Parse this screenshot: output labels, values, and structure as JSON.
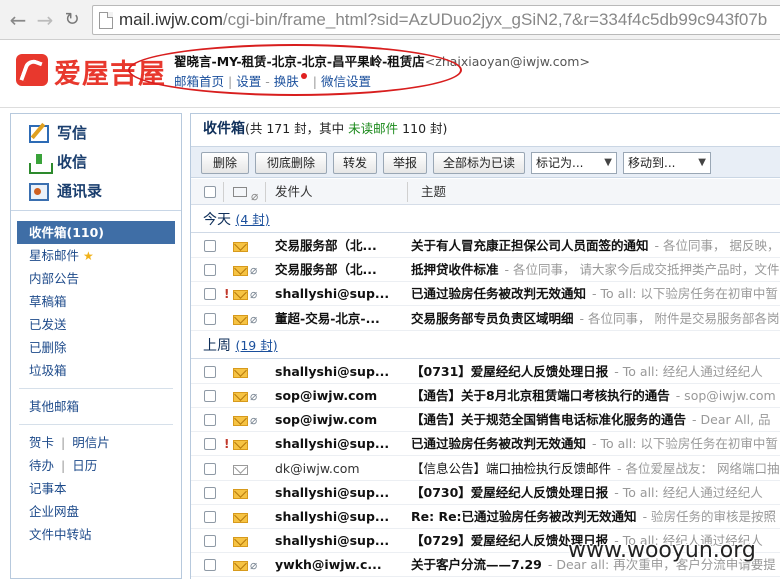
{
  "browser": {
    "url_host": "mail.iwjw.com",
    "url_path": "/cgi-bin/frame_html?sid=AzUDuo2jyx_gSiN2,7&r=334f4c5db99c943f07b"
  },
  "header": {
    "logo_text": "爱屋吉屋",
    "account_name": "翟晓言-MY-租赁-北京-北京-昌平果岭-租赁店",
    "account_email": "<zhaixiaoyan@iwjw.com>",
    "links": [
      "邮箱首页",
      "设置",
      "换肤",
      "微信设置"
    ]
  },
  "sidebar": {
    "quick": [
      {
        "label": "写信",
        "icon": "compose-icon"
      },
      {
        "label": "收信",
        "icon": "receive-icon"
      },
      {
        "label": "通讯录",
        "icon": "address-book-icon"
      }
    ],
    "folders": [
      {
        "label": "收件箱(110)",
        "active": true
      },
      {
        "label": "星标邮件",
        "star": true
      },
      {
        "label": "内部公告"
      },
      {
        "label": "草稿箱"
      },
      {
        "label": "已发送"
      },
      {
        "label": "已删除"
      },
      {
        "label": "垃圾箱"
      }
    ],
    "other": "其他邮箱",
    "tools": [
      [
        "贺卡",
        "明信片"
      ],
      [
        "待办",
        "日历"
      ]
    ],
    "extras": [
      "记事本",
      "企业网盘",
      "文件中转站"
    ]
  },
  "inbox": {
    "title": "收件箱",
    "summary_pre": "(共 171 封，其中",
    "unread_label": "未读邮件",
    "summary_post": "110 封)",
    "toolbar": {
      "delete": "删除",
      "perm_delete": "彻底删除",
      "forward": "转发",
      "report": "举报",
      "mark_all_read": "全部标为已读",
      "mark_as": "标记为...",
      "move_to": "移动到..."
    },
    "columns": {
      "sender": "发件人",
      "subject": "主题"
    },
    "groups": [
      {
        "label": "今天",
        "count": "(4 封)",
        "rows": [
          {
            "sender": "交易服务部（北...",
            "subject": "关于有人冒充康正担保公司人员面签的通知",
            "preview": "- 各位同事， 据反映，",
            "read": false,
            "attach": false,
            "flag": false
          },
          {
            "sender": "交易服务部（北...",
            "subject": "抵押贷收件标准",
            "preview": "- 各位同事， 请大家今后成交抵押类产品时，文件",
            "read": false,
            "attach": true,
            "flag": false
          },
          {
            "sender": "shallyshi@sup...",
            "subject": "已通过验房任务被改判无效通知",
            "preview": "- To all: 以下验房任务在初审中暂",
            "read": false,
            "attach": true,
            "flag": true
          },
          {
            "sender": "董超-交易-北京-...",
            "subject": "交易服务部专员负责区域明细",
            "preview": "- 各位同事， 附件是交易服务部各岗",
            "read": false,
            "attach": true,
            "flag": false
          }
        ]
      },
      {
        "label": "上周",
        "count": "(19 封)",
        "rows": [
          {
            "sender": "shallyshi@sup...",
            "subject": "【0731】爱屋经纪人反馈处理日报",
            "preview": "- To all: 经纪人通过经纪人",
            "read": false,
            "attach": false,
            "flag": false
          },
          {
            "sender": "sop@iwjw.com",
            "subject": "【通告】关于8月北京租赁端口考核执行的通告",
            "preview": "- sop@iwjw.com",
            "read": false,
            "attach": true,
            "flag": false
          },
          {
            "sender": "sop@iwjw.com",
            "subject": "【通告】关于规范全国销售电话标准化服务的通告",
            "preview": "- Dear All, 品",
            "read": false,
            "attach": true,
            "flag": false
          },
          {
            "sender": "shallyshi@sup...",
            "subject": "已通过验房任务被改判无效通知",
            "preview": "- To all: 以下验房任务在初审中暂",
            "read": false,
            "attach": false,
            "flag": true
          },
          {
            "sender": "dk@iwjw.com",
            "subject": "【信息公告】端口抽检执行反馈邮件",
            "preview": "- 各位爱屋战友： 网络端口抽检",
            "read": true,
            "attach": false,
            "flag": false
          },
          {
            "sender": "shallyshi@sup...",
            "subject": "【0730】爱屋经纪人反馈处理日报",
            "preview": "- To all: 经纪人通过经纪人",
            "read": false,
            "attach": false,
            "flag": false
          },
          {
            "sender": "shallyshi@sup...",
            "subject": "Re: Re:已通过验房任务被改判无效通知",
            "preview": "- 验房任务的审核是按照",
            "read": false,
            "attach": false,
            "flag": false
          },
          {
            "sender": "shallyshi@sup...",
            "subject": "【0729】爱屋经纪人反馈处理日报",
            "preview": "- To all: 经纪人通过经纪人",
            "read": false,
            "attach": false,
            "flag": false
          },
          {
            "sender": "ywkh@iwjw.c...",
            "subject": "关于客户分流——7.29",
            "preview": "- Dear all: 再次重申，客户分流申请要提",
            "read": false,
            "attach": true,
            "flag": false
          }
        ]
      }
    ]
  },
  "watermark": "www.wooyun.org"
}
